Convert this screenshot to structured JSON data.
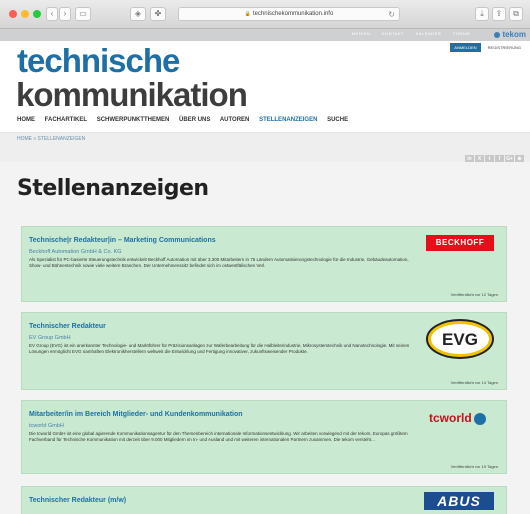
{
  "browser": {
    "url": "technischekommunikation.info"
  },
  "topbar": {
    "links": [
      "MEDIEN",
      "KONTAKT",
      "KALENDER",
      "FORUM"
    ],
    "brand": "tekom"
  },
  "header": {
    "logo_line1": "technische",
    "logo_line2": "kommunikation",
    "login_label": "ANMELDEN",
    "register_label": "REGISTRIERUNG"
  },
  "nav": {
    "items": [
      "HOME",
      "FACHARTIKEL",
      "SCHWERPUNKTTHEMEN",
      "ÜBER UNS",
      "AUTOREN",
      "STELLENANZEIGEN",
      "SUCHE"
    ],
    "active_index": 5
  },
  "breadcrumb": "HOME » STELLENANZEIGEN",
  "social": [
    "in",
    "X",
    "t",
    "f",
    "G+",
    "⊕"
  ],
  "page": {
    "title": "Stellenanzeigen"
  },
  "jobs": [
    {
      "title": "Technische|r Redakteur|in – Marketing Communications",
      "company": "Beckhoff Automation GmbH & Co. KG",
      "description": "Als Spezialist für PC-basierte Steuerungstechnik entwickelt Beckhoff Automation mit über 3.300 Mitarbeitern in 75 Ländern Automatisierungstechnologie für die Industrie, Gebäudeautomation, Show- und Bühnentechnik sowie viele weitere Branchen. Der Unternehmenssitz befindet sich im ostwestfälischen Verl.",
      "date": "Veröffentlicht vor 12 Tagen",
      "logo_text": "BECKHOFF"
    },
    {
      "title": "Technischer Redakteur",
      "company": "EV Group GmbH",
      "description": "EV Group (EVG) ist ein anerkannter Technologie- und Marktführer für Präzisionsanlagen zur Waferbearbeitung für die Halbleiterindustrie, Mikrosystemtechnik und Nanotechnologie. Mit seinen Lösungen ermöglicht EVG namhaften Elektronikherstellern weltweit die Entwicklung und Fertigung innovativer, zukunftsweisender Produkte.",
      "date": "Veröffentlicht vor 14 Tagen",
      "logo_text": "EVG"
    },
    {
      "title": "Mitarbeiter/in im Bereich Mitglieder- und Kundenkommunikation",
      "company": "tcworld GmbH",
      "description": "Die tcworld GmbH ist eine global agierende Kommunikationsagentur für den Themenbereich internationale Informationsentwicklung. Wir arbeiten vorwiegend mit der tekom, Europas größtem Fachverband für Technische Kommunikation mit derzeit über 9.000 Mitgliedern im In- und Ausland und mit weiteren internationalen Partnern zusammen. Die tekom versteht...",
      "date": "Veröffentlicht vor 19 Tagen",
      "logo_text": "tcworld"
    },
    {
      "title": "Technischer Redakteur (m/w)",
      "company": "ABUS",
      "description": "",
      "date": "",
      "logo_text": "ABUS"
    }
  ]
}
